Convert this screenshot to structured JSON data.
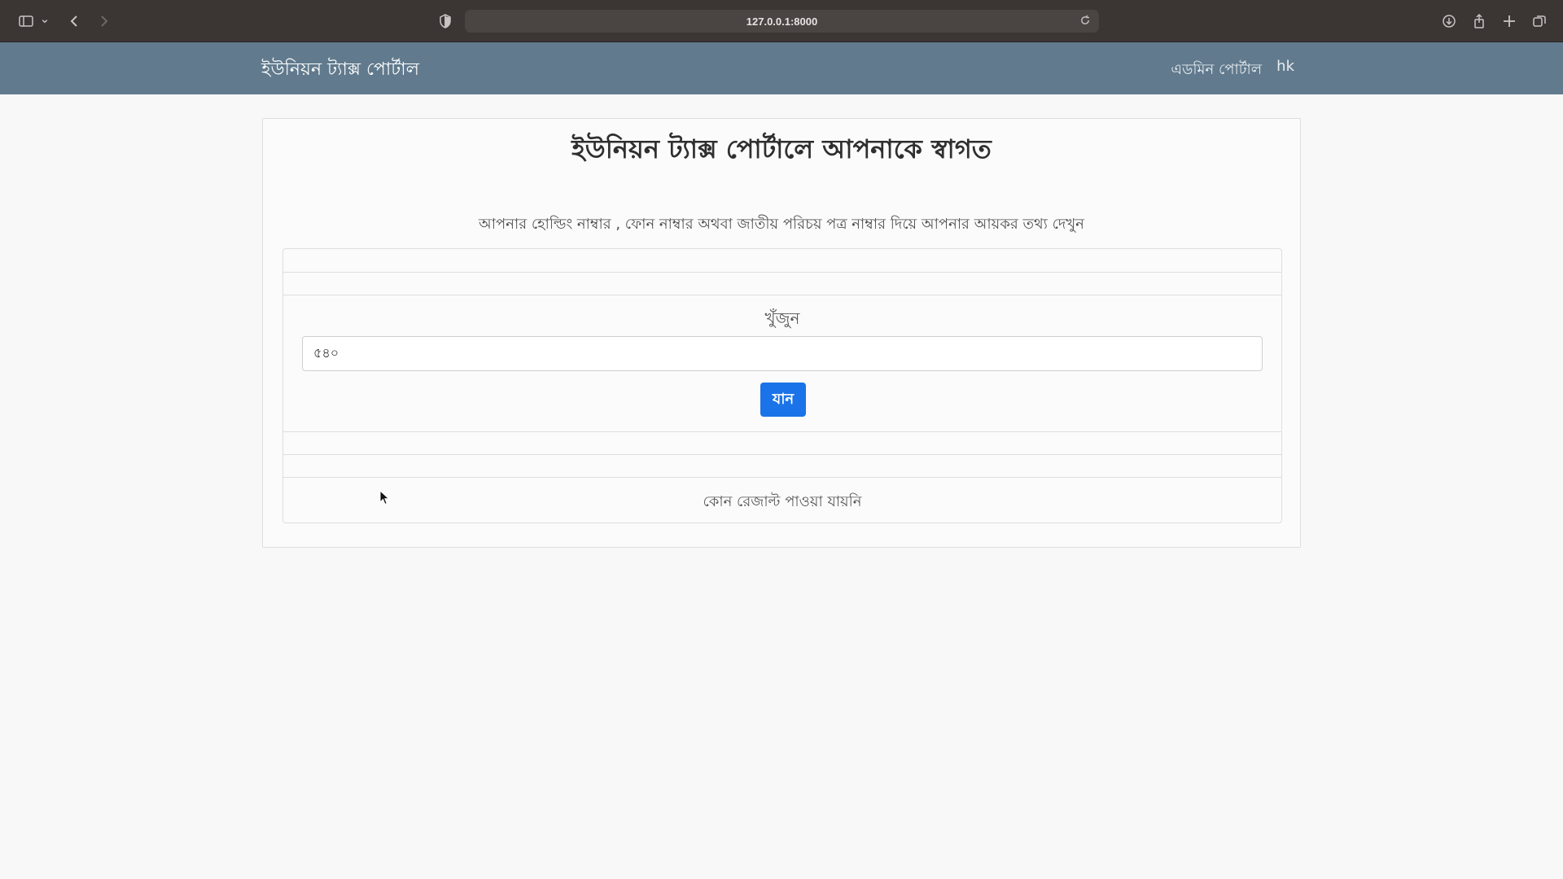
{
  "browser": {
    "url": "127.0.0.1:8000"
  },
  "navbar": {
    "brand": "ইউনিয়ন ট্যাক্স পোর্টাল",
    "links": [
      "এডমিন পোর্টাল",
      "hk"
    ]
  },
  "main": {
    "title": "ইউনিয়ন ট্যাক্স পোর্টালে আপনাকে স্বাগত",
    "subtitle": "আপনার হোল্ডিং নাম্বার , ফোন নাম্বার অথবা জাতীয় পরিচয় পত্র নাম্বার দিয়ে আপনার আয়কর তথ্য দেখুন",
    "search": {
      "label": "খুঁজুন",
      "value": "৫৪০",
      "button_label": "যান"
    },
    "result_message": "কোন রেজাল্ট পাওয়া যায়নি"
  },
  "colors": {
    "navbar": "#617a8d",
    "button": "#1a73e8",
    "chrome": "#3b3534"
  }
}
